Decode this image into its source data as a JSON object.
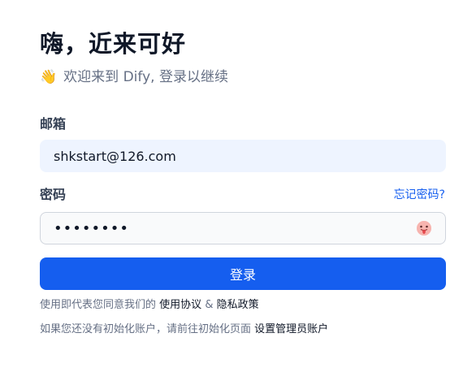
{
  "header": {
    "title": "嗨，近来可好",
    "subtitle": "欢迎来到 Dify, 登录以继续",
    "wave_icon": "👋"
  },
  "email": {
    "label": "邮箱",
    "value": "shkstart@126.com"
  },
  "password": {
    "label": "密码",
    "masked_value": "••••••••",
    "forgot_label": "忘记密码?",
    "reveal_icon": "😛"
  },
  "login_button": {
    "label": "登录"
  },
  "terms": {
    "prefix": "使用即代表您同意我们的",
    "terms_link": "使用协议",
    "separator": "&",
    "privacy_link": "隐私政策"
  },
  "setup": {
    "prefix": "如果您还没有初始化账户，请前往初始化页面",
    "link": "设置管理员账户"
  },
  "colors": {
    "primary": "#155eef",
    "title": "#101828",
    "muted": "#667085",
    "input_bg": "#eef4ff"
  }
}
